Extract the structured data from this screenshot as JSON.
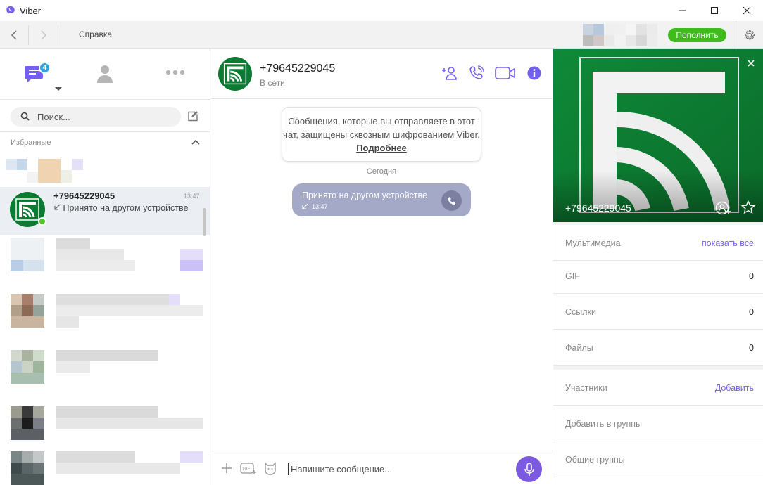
{
  "window": {
    "title": "Viber"
  },
  "toolbar": {
    "help_menu": "Справка",
    "topup_label": "Пополнить"
  },
  "left": {
    "unread_badge": "4",
    "search_placeholder": "Поиск...",
    "favorites_label": "Избранные",
    "active_chat": {
      "name": "+79645229045",
      "time": "13:47",
      "preview": "Принято на другом устройстве",
      "online": true
    }
  },
  "chat": {
    "contact_name": "+79645229045",
    "status": "В сети",
    "encryption_notice": "Сообщения, которые вы отправляете в этот чат, защищены сквозным шифрованием Viber.",
    "encryption_link": "Подробнее",
    "date_separator": "Сегодня",
    "call_message": {
      "text": "Принято на другом устройстве",
      "time": "13:47"
    },
    "composer_placeholder": "Напишите сообщение..."
  },
  "profile": {
    "name": "+79645229045",
    "media_label": "Мультимедиа",
    "media_link": "показать все",
    "gif_label": "GIF",
    "gif_count": "0",
    "links_label": "Ссылки",
    "links_count": "0",
    "files_label": "Файлы",
    "files_count": "0",
    "participants_label": "Участники",
    "participants_link": "Добавить",
    "add_to_groups": "Добавить в группы",
    "common_groups": "Общие группы"
  },
  "colors": {
    "viber_purple": "#7360f2",
    "topup_green": "#3fbb1c",
    "online_green": "#4fc62a",
    "badge_blue": "#2ea7e0",
    "call_bubble": "#a5a9c8",
    "avatar_green": "#0c7a32"
  }
}
